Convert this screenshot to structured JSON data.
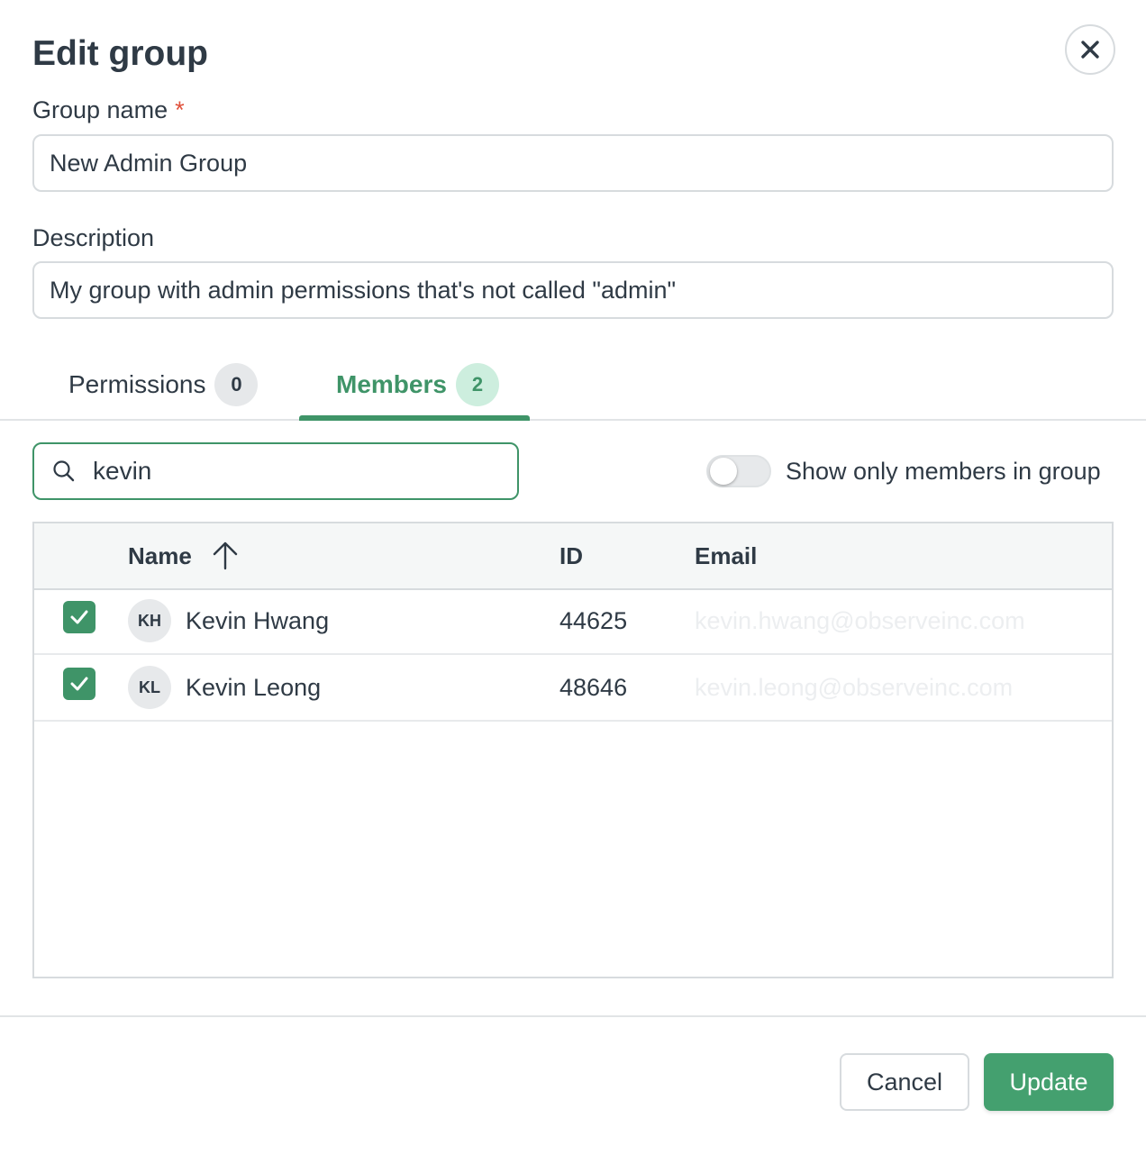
{
  "dialog": {
    "title": "Edit group"
  },
  "form": {
    "group_name_label": "Group name",
    "required_mark": "*",
    "group_name_value": "New Admin Group",
    "description_label": "Description",
    "description_value": "My group with admin permissions that's not called \"admin\""
  },
  "tabs": [
    {
      "label": "Permissions",
      "count": "0",
      "active": false
    },
    {
      "label": "Members",
      "count": "2",
      "active": true
    }
  ],
  "search": {
    "value": "kevin"
  },
  "toggle": {
    "label": "Show only members in group",
    "on": false
  },
  "table": {
    "headers": {
      "name": "Name",
      "id": "ID",
      "email": "Email"
    },
    "sort": "Name ascending",
    "rows": [
      {
        "checked": true,
        "initials": "KH",
        "name": "Kevin Hwang",
        "id": "44625",
        "email": "kevin.hwang@observeinc.com"
      },
      {
        "checked": true,
        "initials": "KL",
        "name": "Kevin Leong",
        "id": "48646",
        "email": "kevin.leong@observeinc.com"
      }
    ]
  },
  "footer": {
    "cancel_label": "Cancel",
    "update_label": "Update"
  },
  "colors": {
    "accent": "#3f9468",
    "primary_button": "#44a06f",
    "required": "#e0513c"
  }
}
